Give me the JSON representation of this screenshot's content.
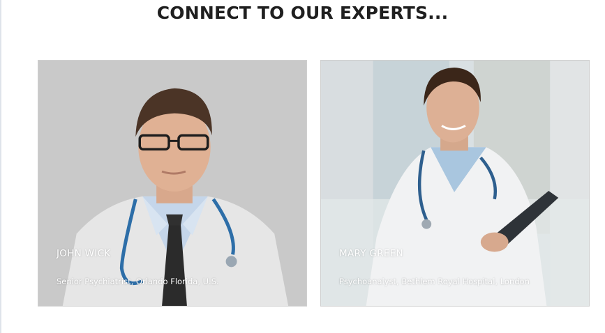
{
  "heading": "CONNECT TO OUR EXPERTS...",
  "experts": [
    {
      "name": "JOHN WICK",
      "role": "Senior Psychiatrist, Orlando Florida, U.S."
    },
    {
      "name": "MARY GREEN",
      "role": "Psychoanalyst, Bethlem Royal Hospital, London"
    }
  ],
  "colors": {
    "heading_text": "#1f1f1f",
    "card1_background": "#cacaca",
    "card2_background": "#dfe3e4",
    "overlay_text": "#ffffff"
  }
}
